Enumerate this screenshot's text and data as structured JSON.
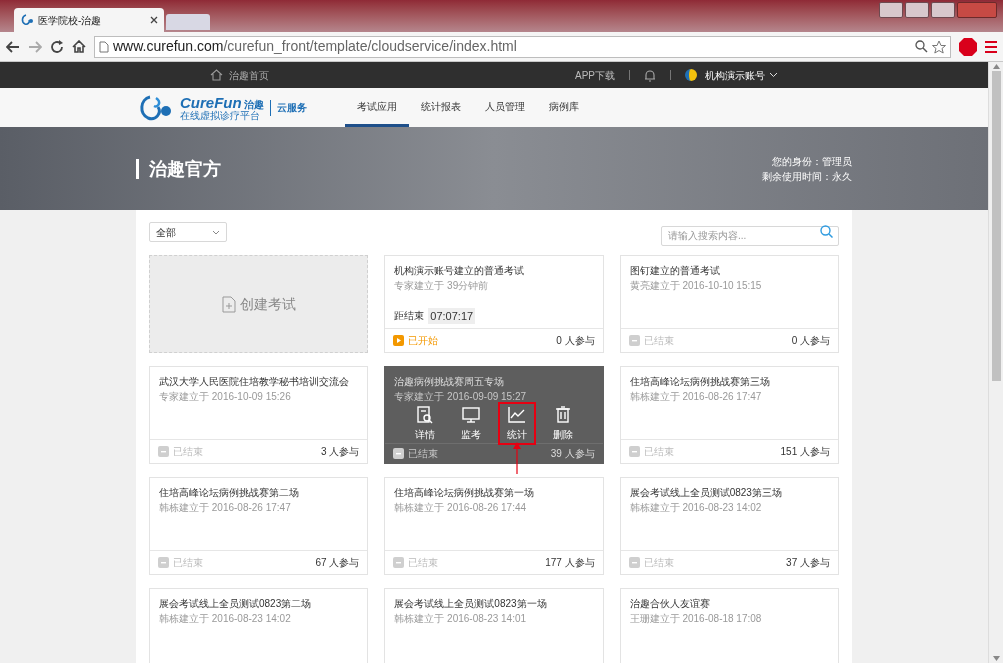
{
  "browser": {
    "tab_title": "医学院校-治趣",
    "url_host": "www.curefun.com",
    "url_path": "/curefun_front/template/cloudservice/index.html"
  },
  "top_bar": {
    "home": "治趣首页",
    "app_download": "APP下载",
    "account": "机构演示账号"
  },
  "nav": {
    "logo_name": "CureFun",
    "logo_cn": "治趣",
    "logo_sub": "在线虚拟诊疗平台",
    "service": "云服务",
    "items": [
      {
        "label": "考试应用",
        "selected": true
      },
      {
        "label": "统计报表",
        "selected": false
      },
      {
        "label": "人员管理",
        "selected": false
      },
      {
        "label": "病例库",
        "selected": false
      }
    ]
  },
  "hero": {
    "title": "治趣官方",
    "identity": "您的身份：管理员",
    "remaining": "剩余使用时间：永久"
  },
  "filter": {
    "value": "全部"
  },
  "search": {
    "placeholder": "请输入搜索内容..."
  },
  "create_label": "创建考试",
  "exams": [
    {
      "title": "机构演示账号建立的普通考试",
      "creator": "专家建立于 39分钟前",
      "countdown_label": "距结束",
      "countdown": "07:07:17",
      "started": true,
      "status_label": "已开始",
      "participants": "0 人参与",
      "hovered": false
    },
    {
      "title": "图钉建立的普通考试",
      "creator": "黄亮建立于 2016-10-10 15:15",
      "started": false,
      "status_label": "已结束",
      "participants": "0 人参与",
      "hovered": false
    },
    {
      "title": "武汉大学人民医院住培教学秘书培训交流会",
      "creator": "专家建立于 2016-10-09 15:26",
      "started": false,
      "status_label": "已结束",
      "participants": "3 人参与",
      "hovered": false
    },
    {
      "title": "治趣病例挑战赛周五专场",
      "creator": "专家建立于 2016-09-09 15:27",
      "started": false,
      "status_label": "已结束",
      "participants": "39 人参与",
      "hovered": true,
      "actions": [
        {
          "kind": "detail",
          "label": "详情",
          "highlighted": false
        },
        {
          "kind": "monitor",
          "label": "监考",
          "highlighted": false
        },
        {
          "kind": "stats",
          "label": "统计",
          "highlighted": true
        },
        {
          "kind": "delete",
          "label": "删除",
          "highlighted": false
        }
      ]
    },
    {
      "title": "住培高峰论坛病例挑战赛第三场",
      "creator": "韩栋建立于 2016-08-26 17:47",
      "started": false,
      "status_label": "已结束",
      "participants": "151 人参与",
      "hovered": false
    },
    {
      "title": "住培高峰论坛病例挑战赛第二场",
      "creator": "韩栋建立于 2016-08-26 17:47",
      "started": false,
      "status_label": "已结束",
      "participants": "67 人参与",
      "hovered": false
    },
    {
      "title": "住培高峰论坛病例挑战赛第一场",
      "creator": "韩栋建立于 2016-08-26 17:44",
      "started": false,
      "status_label": "已结束",
      "participants": "177 人参与",
      "hovered": false
    },
    {
      "title": "展会考试线上全员测试0823第三场",
      "creator": "韩栋建立于 2016-08-23 14:02",
      "started": false,
      "status_label": "已结束",
      "participants": "37 人参与",
      "hovered": false
    },
    {
      "title": "展会考试线上全员测试0823第二场",
      "creator": "韩栋建立于 2016-08-23 14:02",
      "hovered": false
    },
    {
      "title": "展会考试线上全员测试0823第一场",
      "creator": "韩栋建立于 2016-08-23 14:01",
      "hovered": false
    },
    {
      "title": "治趣合伙人友谊赛",
      "creator": "王珊建立于 2016-08-18 17:08",
      "hovered": false
    }
  ]
}
